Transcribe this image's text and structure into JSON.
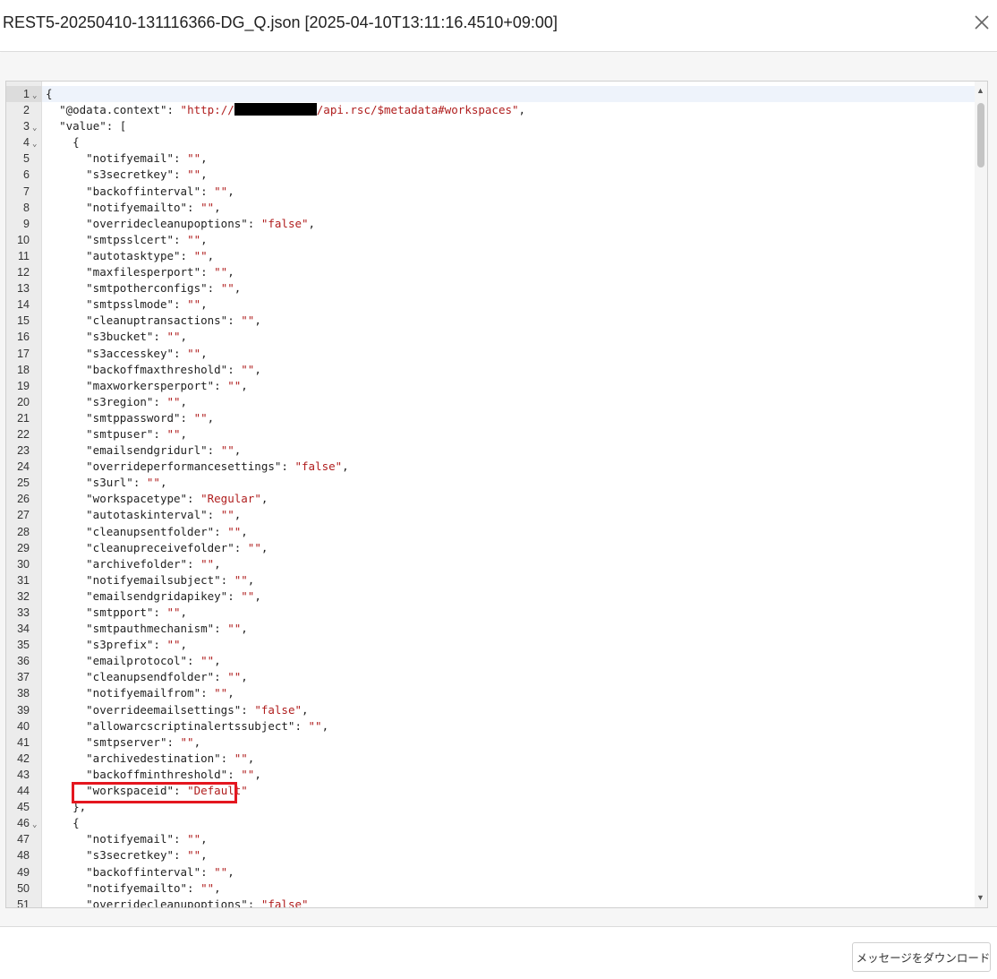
{
  "window": {
    "title": "REST5-20250410-131116366-DG_Q.json [2025-04-10T13:11:16.4510+09:00]",
    "close_icon": "close-icon"
  },
  "editor": {
    "lines": [
      {
        "n": "1",
        "fold": true,
        "tokens": [
          [
            "p",
            "{"
          ]
        ]
      },
      {
        "n": "2",
        "tokens": [
          [
            "p",
            "  "
          ],
          [
            "k",
            "\"@odata.context\""
          ],
          [
            "p",
            ": "
          ],
          [
            "s",
            "\"http://"
          ],
          [
            "redact",
            ""
          ],
          [
            "s",
            "/api.rsc/$metadata#workspaces\""
          ],
          [
            "p",
            ","
          ]
        ]
      },
      {
        "n": "3",
        "fold": true,
        "tokens": [
          [
            "p",
            "  "
          ],
          [
            "k",
            "\"value\""
          ],
          [
            "p",
            ": ["
          ]
        ]
      },
      {
        "n": "4",
        "fold": true,
        "tokens": [
          [
            "p",
            "    {"
          ]
        ]
      },
      {
        "n": "5",
        "tokens": [
          [
            "p",
            "      "
          ],
          [
            "k",
            "\"notifyemail\""
          ],
          [
            "p",
            ": "
          ],
          [
            "s",
            "\"\""
          ],
          [
            "p",
            ","
          ]
        ]
      },
      {
        "n": "6",
        "tokens": [
          [
            "p",
            "      "
          ],
          [
            "k",
            "\"s3secretkey\""
          ],
          [
            "p",
            ": "
          ],
          [
            "s",
            "\"\""
          ],
          [
            "p",
            ","
          ]
        ]
      },
      {
        "n": "7",
        "tokens": [
          [
            "p",
            "      "
          ],
          [
            "k",
            "\"backoffinterval\""
          ],
          [
            "p",
            ": "
          ],
          [
            "s",
            "\"\""
          ],
          [
            "p",
            ","
          ]
        ]
      },
      {
        "n": "8",
        "tokens": [
          [
            "p",
            "      "
          ],
          [
            "k",
            "\"notifyemailto\""
          ],
          [
            "p",
            ": "
          ],
          [
            "s",
            "\"\""
          ],
          [
            "p",
            ","
          ]
        ]
      },
      {
        "n": "9",
        "tokens": [
          [
            "p",
            "      "
          ],
          [
            "k",
            "\"overridecleanupoptions\""
          ],
          [
            "p",
            ": "
          ],
          [
            "s",
            "\"false\""
          ],
          [
            "p",
            ","
          ]
        ]
      },
      {
        "n": "10",
        "tokens": [
          [
            "p",
            "      "
          ],
          [
            "k",
            "\"smtpsslcert\""
          ],
          [
            "p",
            ": "
          ],
          [
            "s",
            "\"\""
          ],
          [
            "p",
            ","
          ]
        ]
      },
      {
        "n": "11",
        "tokens": [
          [
            "p",
            "      "
          ],
          [
            "k",
            "\"autotasktype\""
          ],
          [
            "p",
            ": "
          ],
          [
            "s",
            "\"\""
          ],
          [
            "p",
            ","
          ]
        ]
      },
      {
        "n": "12",
        "tokens": [
          [
            "p",
            "      "
          ],
          [
            "k",
            "\"maxfilesperport\""
          ],
          [
            "p",
            ": "
          ],
          [
            "s",
            "\"\""
          ],
          [
            "p",
            ","
          ]
        ]
      },
      {
        "n": "13",
        "tokens": [
          [
            "p",
            "      "
          ],
          [
            "k",
            "\"smtpotherconfigs\""
          ],
          [
            "p",
            ": "
          ],
          [
            "s",
            "\"\""
          ],
          [
            "p",
            ","
          ]
        ]
      },
      {
        "n": "14",
        "tokens": [
          [
            "p",
            "      "
          ],
          [
            "k",
            "\"smtpsslmode\""
          ],
          [
            "p",
            ": "
          ],
          [
            "s",
            "\"\""
          ],
          [
            "p",
            ","
          ]
        ]
      },
      {
        "n": "15",
        "tokens": [
          [
            "p",
            "      "
          ],
          [
            "k",
            "\"cleanuptransactions\""
          ],
          [
            "p",
            ": "
          ],
          [
            "s",
            "\"\""
          ],
          [
            "p",
            ","
          ]
        ]
      },
      {
        "n": "16",
        "tokens": [
          [
            "p",
            "      "
          ],
          [
            "k",
            "\"s3bucket\""
          ],
          [
            "p",
            ": "
          ],
          [
            "s",
            "\"\""
          ],
          [
            "p",
            ","
          ]
        ]
      },
      {
        "n": "17",
        "tokens": [
          [
            "p",
            "      "
          ],
          [
            "k",
            "\"s3accesskey\""
          ],
          [
            "p",
            ": "
          ],
          [
            "s",
            "\"\""
          ],
          [
            "p",
            ","
          ]
        ]
      },
      {
        "n": "18",
        "tokens": [
          [
            "p",
            "      "
          ],
          [
            "k",
            "\"backoffmaxthreshold\""
          ],
          [
            "p",
            ": "
          ],
          [
            "s",
            "\"\""
          ],
          [
            "p",
            ","
          ]
        ]
      },
      {
        "n": "19",
        "tokens": [
          [
            "p",
            "      "
          ],
          [
            "k",
            "\"maxworkersperport\""
          ],
          [
            "p",
            ": "
          ],
          [
            "s",
            "\"\""
          ],
          [
            "p",
            ","
          ]
        ]
      },
      {
        "n": "20",
        "tokens": [
          [
            "p",
            "      "
          ],
          [
            "k",
            "\"s3region\""
          ],
          [
            "p",
            ": "
          ],
          [
            "s",
            "\"\""
          ],
          [
            "p",
            ","
          ]
        ]
      },
      {
        "n": "21",
        "tokens": [
          [
            "p",
            "      "
          ],
          [
            "k",
            "\"smtppassword\""
          ],
          [
            "p",
            ": "
          ],
          [
            "s",
            "\"\""
          ],
          [
            "p",
            ","
          ]
        ]
      },
      {
        "n": "22",
        "tokens": [
          [
            "p",
            "      "
          ],
          [
            "k",
            "\"smtpuser\""
          ],
          [
            "p",
            ": "
          ],
          [
            "s",
            "\"\""
          ],
          [
            "p",
            ","
          ]
        ]
      },
      {
        "n": "23",
        "tokens": [
          [
            "p",
            "      "
          ],
          [
            "k",
            "\"emailsendgridurl\""
          ],
          [
            "p",
            ": "
          ],
          [
            "s",
            "\"\""
          ],
          [
            "p",
            ","
          ]
        ]
      },
      {
        "n": "24",
        "tokens": [
          [
            "p",
            "      "
          ],
          [
            "k",
            "\"overrideperformancesettings\""
          ],
          [
            "p",
            ": "
          ],
          [
            "s",
            "\"false\""
          ],
          [
            "p",
            ","
          ]
        ]
      },
      {
        "n": "25",
        "tokens": [
          [
            "p",
            "      "
          ],
          [
            "k",
            "\"s3url\""
          ],
          [
            "p",
            ": "
          ],
          [
            "s",
            "\"\""
          ],
          [
            "p",
            ","
          ]
        ]
      },
      {
        "n": "26",
        "tokens": [
          [
            "p",
            "      "
          ],
          [
            "k",
            "\"workspacetype\""
          ],
          [
            "p",
            ": "
          ],
          [
            "s",
            "\"Regular\""
          ],
          [
            "p",
            ","
          ]
        ]
      },
      {
        "n": "27",
        "tokens": [
          [
            "p",
            "      "
          ],
          [
            "k",
            "\"autotaskinterval\""
          ],
          [
            "p",
            ": "
          ],
          [
            "s",
            "\"\""
          ],
          [
            "p",
            ","
          ]
        ]
      },
      {
        "n": "28",
        "tokens": [
          [
            "p",
            "      "
          ],
          [
            "k",
            "\"cleanupsentfolder\""
          ],
          [
            "p",
            ": "
          ],
          [
            "s",
            "\"\""
          ],
          [
            "p",
            ","
          ]
        ]
      },
      {
        "n": "29",
        "tokens": [
          [
            "p",
            "      "
          ],
          [
            "k",
            "\"cleanupreceivefolder\""
          ],
          [
            "p",
            ": "
          ],
          [
            "s",
            "\"\""
          ],
          [
            "p",
            ","
          ]
        ]
      },
      {
        "n": "30",
        "tokens": [
          [
            "p",
            "      "
          ],
          [
            "k",
            "\"archivefolder\""
          ],
          [
            "p",
            ": "
          ],
          [
            "s",
            "\"\""
          ],
          [
            "p",
            ","
          ]
        ]
      },
      {
        "n": "31",
        "tokens": [
          [
            "p",
            "      "
          ],
          [
            "k",
            "\"notifyemailsubject\""
          ],
          [
            "p",
            ": "
          ],
          [
            "s",
            "\"\""
          ],
          [
            "p",
            ","
          ]
        ]
      },
      {
        "n": "32",
        "tokens": [
          [
            "p",
            "      "
          ],
          [
            "k",
            "\"emailsendgridapikey\""
          ],
          [
            "p",
            ": "
          ],
          [
            "s",
            "\"\""
          ],
          [
            "p",
            ","
          ]
        ]
      },
      {
        "n": "33",
        "tokens": [
          [
            "p",
            "      "
          ],
          [
            "k",
            "\"smtpport\""
          ],
          [
            "p",
            ": "
          ],
          [
            "s",
            "\"\""
          ],
          [
            "p",
            ","
          ]
        ]
      },
      {
        "n": "34",
        "tokens": [
          [
            "p",
            "      "
          ],
          [
            "k",
            "\"smtpauthmechanism\""
          ],
          [
            "p",
            ": "
          ],
          [
            "s",
            "\"\""
          ],
          [
            "p",
            ","
          ]
        ]
      },
      {
        "n": "35",
        "tokens": [
          [
            "p",
            "      "
          ],
          [
            "k",
            "\"s3prefix\""
          ],
          [
            "p",
            ": "
          ],
          [
            "s",
            "\"\""
          ],
          [
            "p",
            ","
          ]
        ]
      },
      {
        "n": "36",
        "tokens": [
          [
            "p",
            "      "
          ],
          [
            "k",
            "\"emailprotocol\""
          ],
          [
            "p",
            ": "
          ],
          [
            "s",
            "\"\""
          ],
          [
            "p",
            ","
          ]
        ]
      },
      {
        "n": "37",
        "tokens": [
          [
            "p",
            "      "
          ],
          [
            "k",
            "\"cleanupsendfolder\""
          ],
          [
            "p",
            ": "
          ],
          [
            "s",
            "\"\""
          ],
          [
            "p",
            ","
          ]
        ]
      },
      {
        "n": "38",
        "tokens": [
          [
            "p",
            "      "
          ],
          [
            "k",
            "\"notifyemailfrom\""
          ],
          [
            "p",
            ": "
          ],
          [
            "s",
            "\"\""
          ],
          [
            "p",
            ","
          ]
        ]
      },
      {
        "n": "39",
        "tokens": [
          [
            "p",
            "      "
          ],
          [
            "k",
            "\"overrideemailsettings\""
          ],
          [
            "p",
            ": "
          ],
          [
            "s",
            "\"false\""
          ],
          [
            "p",
            ","
          ]
        ]
      },
      {
        "n": "40",
        "tokens": [
          [
            "p",
            "      "
          ],
          [
            "k",
            "\"allowarcscriptinalertssubject\""
          ],
          [
            "p",
            ": "
          ],
          [
            "s",
            "\"\""
          ],
          [
            "p",
            ","
          ]
        ]
      },
      {
        "n": "41",
        "tokens": [
          [
            "p",
            "      "
          ],
          [
            "k",
            "\"smtpserver\""
          ],
          [
            "p",
            ": "
          ],
          [
            "s",
            "\"\""
          ],
          [
            "p",
            ","
          ]
        ]
      },
      {
        "n": "42",
        "tokens": [
          [
            "p",
            "      "
          ],
          [
            "k",
            "\"archivedestination\""
          ],
          [
            "p",
            ": "
          ],
          [
            "s",
            "\"\""
          ],
          [
            "p",
            ","
          ]
        ]
      },
      {
        "n": "43",
        "tokens": [
          [
            "p",
            "      "
          ],
          [
            "k",
            "\"backoffminthreshold\""
          ],
          [
            "p",
            ": "
          ],
          [
            "s",
            "\"\""
          ],
          [
            "p",
            ","
          ]
        ]
      },
      {
        "n": "44",
        "tokens": [
          [
            "p",
            "      "
          ],
          [
            "k",
            "\"workspaceid\""
          ],
          [
            "p",
            ": "
          ],
          [
            "s",
            "\"Default\""
          ]
        ]
      },
      {
        "n": "45",
        "tokens": [
          [
            "p",
            "    },"
          ]
        ]
      },
      {
        "n": "46",
        "fold": true,
        "tokens": [
          [
            "p",
            "    {"
          ]
        ]
      },
      {
        "n": "47",
        "tokens": [
          [
            "p",
            "      "
          ],
          [
            "k",
            "\"notifyemail\""
          ],
          [
            "p",
            ": "
          ],
          [
            "s",
            "\"\""
          ],
          [
            "p",
            ","
          ]
        ]
      },
      {
        "n": "48",
        "tokens": [
          [
            "p",
            "      "
          ],
          [
            "k",
            "\"s3secretkey\""
          ],
          [
            "p",
            ": "
          ],
          [
            "s",
            "\"\""
          ],
          [
            "p",
            ","
          ]
        ]
      },
      {
        "n": "49",
        "tokens": [
          [
            "p",
            "      "
          ],
          [
            "k",
            "\"backoffinterval\""
          ],
          [
            "p",
            ": "
          ],
          [
            "s",
            "\"\""
          ],
          [
            "p",
            ","
          ]
        ]
      },
      {
        "n": "50",
        "tokens": [
          [
            "p",
            "      "
          ],
          [
            "k",
            "\"notifyemailto\""
          ],
          [
            "p",
            ": "
          ],
          [
            "s",
            "\"\""
          ],
          [
            "p",
            ","
          ]
        ]
      },
      {
        "n": "51",
        "tokens": [
          [
            "p",
            "      "
          ],
          [
            "k",
            "\"overridecleanupoptions\""
          ],
          [
            "p",
            ": "
          ],
          [
            "s",
            "\"false\""
          ]
        ]
      }
    ],
    "highlighted_line": "44",
    "highlight_color": "#e4161f",
    "string_color": "#b01e1e"
  },
  "footer": {
    "download_label": "メッセージをダウンロード",
    "download_icon": "download-icon"
  }
}
